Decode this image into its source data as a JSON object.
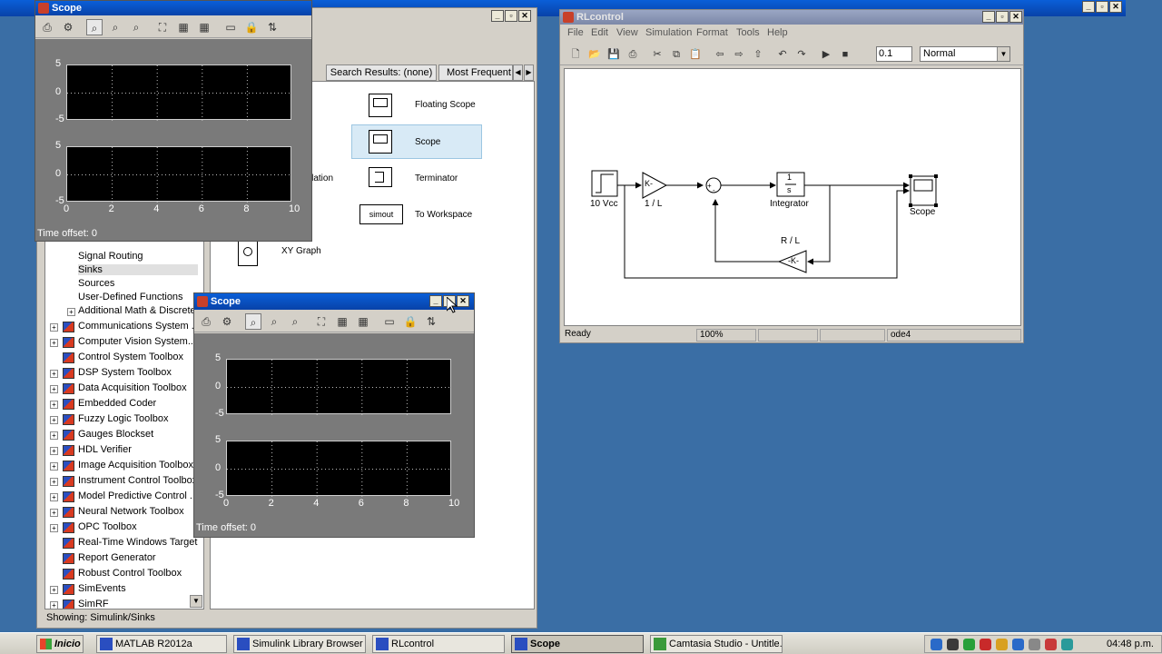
{
  "desktop": {
    "background": "#3a6ea5"
  },
  "scope_big": {
    "title": "Scope",
    "yticks": [
      "5",
      "0",
      "-5"
    ],
    "xticks": [
      "0",
      "2",
      "4",
      "6",
      "8",
      "10"
    ],
    "time_offset": "Time offset:  0"
  },
  "scope_small": {
    "title": "Scope",
    "yticks": [
      "5",
      "0",
      "-5"
    ],
    "xticks": [
      "0",
      "2",
      "4",
      "6",
      "8",
      "10"
    ],
    "time_offset": "Time offset:  0"
  },
  "library": {
    "tabs": [
      "Search Results: (none)",
      "Most Frequent"
    ],
    "blocks": [
      {
        "label": "Floating Scope"
      },
      {
        "label": "Scope"
      },
      {
        "label": "Terminator"
      },
      {
        "label": "To Workspace",
        "text": "simout"
      },
      {
        "label": "XY Graph"
      }
    ],
    "partial_label": "nulation",
    "tree": [
      "Signal Routing",
      "Sinks",
      "Sources",
      "User-Defined Functions",
      "Additional Math & Discrete",
      "Communications System ...",
      "Computer Vision System...",
      "Control System Toolbox",
      "DSP System Toolbox",
      "Data Acquisition Toolbox",
      "Embedded Coder",
      "Fuzzy Logic Toolbox",
      "Gauges Blockset",
      "HDL Verifier",
      "Image Acquisition Toolbox",
      "Instrument Control Toolbox",
      "Model Predictive Control ...",
      "Neural Network Toolbox",
      "OPC Toolbox",
      "Real-Time Windows Target",
      "Report Generator",
      "Robust Control Toolbox",
      "SimEvents",
      "SimRF"
    ],
    "status": "Showing: Simulink/Sinks"
  },
  "model": {
    "title": "RLcontrol",
    "menu": [
      "File",
      "Edit",
      "View",
      "Simulation",
      "Format",
      "Tools",
      "Help"
    ],
    "stop_time": "0.1",
    "sim_mode": "Normal",
    "blocks": {
      "source": "10 Vcc",
      "gain1": "1 / L",
      "gain1_text": "K-",
      "integrator": "Integrator",
      "int_num": "1",
      "int_den": "s",
      "feedback_label": "R / L",
      "feedback_text": "-K-",
      "scope": "Scope"
    },
    "status": {
      "state": "Ready",
      "zoom": "100%",
      "solver": "ode4"
    }
  },
  "taskbar": {
    "start": "Inicio",
    "tasks": [
      "MATLAB  R2012a",
      "Simulink Library Browser",
      "RLcontrol",
      "Scope",
      "Camtasia Studio - Untitle..."
    ],
    "clock": "04:48 p.m."
  }
}
